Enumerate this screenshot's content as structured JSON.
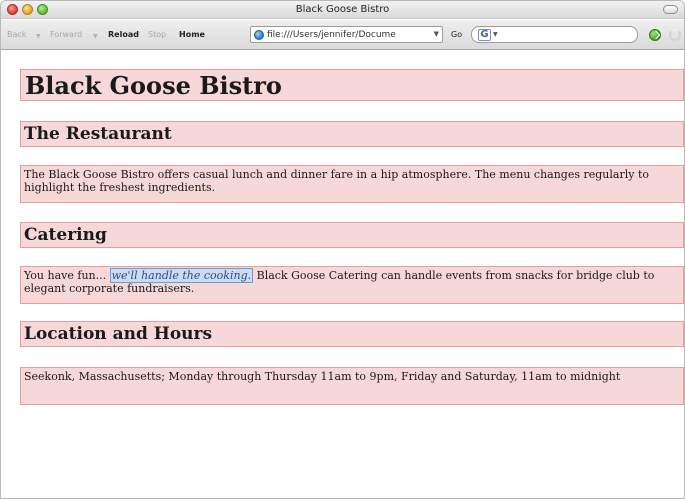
{
  "window": {
    "title": "Black Goose Bistro"
  },
  "toolbar": {
    "back": "Back",
    "forward": "Forward",
    "reload": "Reload",
    "stop": "Stop",
    "home": "Home",
    "url": "file:///Users/jennifer/Docume",
    "go": "Go",
    "search_engine": "G"
  },
  "page": {
    "heading1": "Black Goose Bistro",
    "section1": {
      "heading": "The Restaurant",
      "text": "The Black Goose Bistro offers casual lunch and dinner fare in a hip atmosphere. The menu changes regularly to highlight the freshest ingredients."
    },
    "section2": {
      "heading": "Catering",
      "text_before": "You have fun... ",
      "emphasis": "we'll handle the cooking.",
      "text_after": " Black Goose Catering can handle events from snacks for bridge club to elegant corporate fundraisers."
    },
    "section3": {
      "heading": "Location and Hours",
      "text": "Seekonk, Massachusetts; Monday through Thursday 11am to 9pm, Friday and Saturday, 11am to midnight"
    }
  }
}
